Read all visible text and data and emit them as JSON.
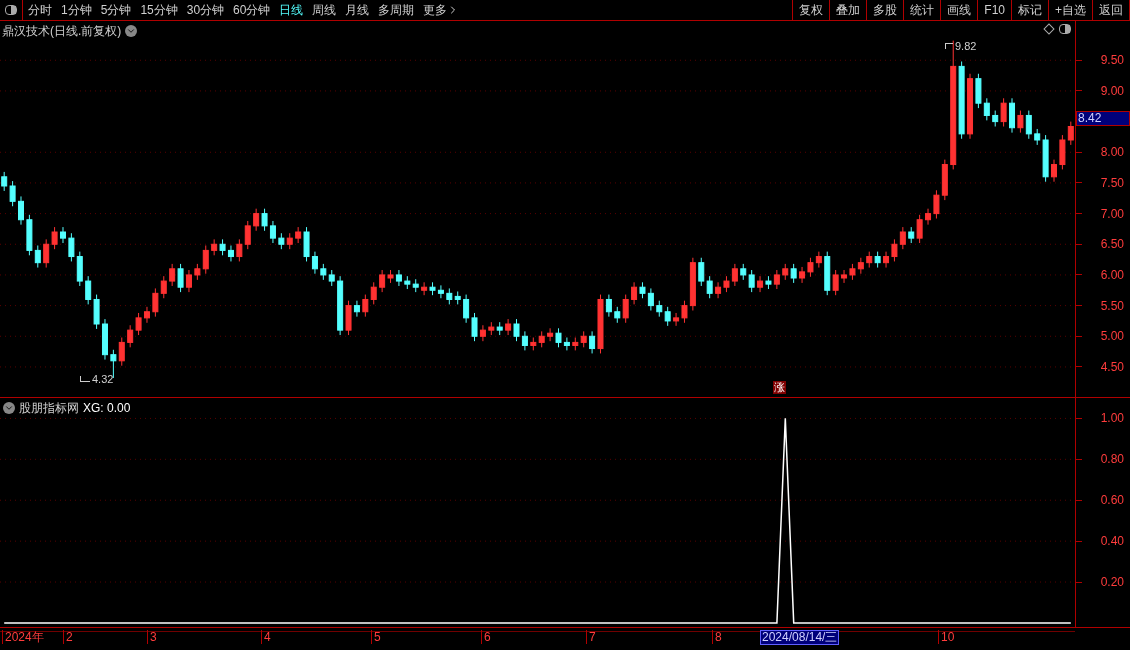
{
  "toolbar": {
    "periods": [
      {
        "label": "分时",
        "selected": false
      },
      {
        "label": "1分钟",
        "selected": false
      },
      {
        "label": "5分钟",
        "selected": false
      },
      {
        "label": "15分钟",
        "selected": false
      },
      {
        "label": "30分钟",
        "selected": false
      },
      {
        "label": "60分钟",
        "selected": false
      },
      {
        "label": "日线",
        "selected": true
      },
      {
        "label": "周线",
        "selected": false
      },
      {
        "label": "月线",
        "selected": false
      },
      {
        "label": "多周期",
        "selected": false
      }
    ],
    "more": "更多",
    "buttons": [
      "复权",
      "叠加",
      "多股",
      "统计",
      "画线",
      "F10",
      "标记",
      "+自选",
      "返回"
    ]
  },
  "price_panel": {
    "title": "鼎汉技术(日线.前复权)",
    "high_marker": "9.82",
    "low_marker": "4.32",
    "current_price": "8.42",
    "signal_label": "涨",
    "chart_data": {
      "type": "candlestick",
      "grid": true,
      "ylim": [
        4.01,
        10.14
      ],
      "yticks": [
        {
          "value": 9.5,
          "label": "9.50"
        },
        {
          "value": 9.0,
          "label": "9.00"
        },
        {
          "value": 8.0,
          "label": "8.00"
        },
        {
          "value": 7.5,
          "label": "7.50"
        },
        {
          "value": 7.0,
          "label": "7.00"
        },
        {
          "value": 6.5,
          "label": "6.50"
        },
        {
          "value": 6.0,
          "label": "6.00"
        },
        {
          "value": 5.5,
          "label": "5.50"
        },
        {
          "value": 5.0,
          "label": "5.00"
        },
        {
          "value": 4.5,
          "label": "4.50"
        }
      ],
      "categories": [
        null,
        null,
        null,
        null,
        null,
        null,
        null,
        null,
        null,
        null,
        null,
        null,
        null,
        null,
        null,
        null,
        null,
        null,
        null,
        null,
        null,
        null,
        null,
        null,
        null,
        null,
        null,
        null,
        null,
        null,
        null,
        null,
        null,
        null,
        null,
        null,
        null,
        null,
        null,
        null,
        null,
        null,
        null,
        null,
        null,
        null,
        null,
        null,
        null,
        null,
        null,
        null,
        null,
        null,
        null,
        null,
        null,
        null,
        null,
        null,
        null,
        null,
        null,
        null,
        null,
        null,
        null,
        null,
        null,
        null,
        null,
        null,
        null,
        null,
        null,
        null,
        null,
        null,
        null,
        null,
        null,
        null,
        null,
        null,
        null,
        null,
        null,
        null,
        null,
        null,
        null,
        null,
        null,
        null,
        null,
        null,
        null,
        null,
        null,
        null,
        null,
        null,
        null,
        null,
        null,
        null,
        null,
        null,
        null,
        null,
        null,
        null,
        null,
        null,
        null,
        null,
        null,
        null,
        null,
        null,
        null,
        null,
        null,
        null,
        null,
        null,
        null,
        null
      ],
      "ohlc": [
        [
          7.6,
          7.68,
          7.37,
          7.45
        ],
        [
          7.45,
          7.53,
          7.12,
          7.2
        ],
        [
          7.2,
          7.28,
          6.82,
          6.9
        ],
        [
          6.9,
          6.98,
          6.32,
          6.4
        ],
        [
          6.4,
          6.48,
          6.12,
          6.2
        ],
        [
          6.2,
          6.58,
          6.12,
          6.5
        ],
        [
          6.5,
          6.78,
          6.42,
          6.7
        ],
        [
          6.7,
          6.78,
          6.52,
          6.6
        ],
        [
          6.6,
          6.68,
          6.22,
          6.3
        ],
        [
          6.3,
          6.38,
          5.82,
          5.9
        ],
        [
          5.9,
          5.98,
          5.52,
          5.6
        ],
        [
          5.6,
          5.68,
          5.12,
          5.2
        ],
        [
          5.2,
          5.28,
          4.62,
          4.7
        ],
        [
          4.7,
          4.78,
          4.32,
          4.6
        ],
        [
          4.6,
          4.98,
          4.52,
          4.9
        ],
        [
          4.9,
          5.18,
          4.82,
          5.1
        ],
        [
          5.1,
          5.38,
          5.02,
          5.3
        ],
        [
          5.3,
          5.48,
          5.22,
          5.4
        ],
        [
          5.4,
          5.78,
          5.32,
          5.7
        ],
        [
          5.7,
          5.98,
          5.62,
          5.9
        ],
        [
          5.9,
          6.18,
          5.82,
          6.1
        ],
        [
          6.1,
          6.18,
          5.72,
          5.8
        ],
        [
          5.8,
          6.08,
          5.72,
          6.0
        ],
        [
          6.0,
          6.18,
          5.92,
          6.1
        ],
        [
          6.1,
          6.48,
          6.02,
          6.4
        ],
        [
          6.4,
          6.58,
          6.32,
          6.5
        ],
        [
          6.5,
          6.58,
          6.32,
          6.4
        ],
        [
          6.4,
          6.48,
          6.22,
          6.3
        ],
        [
          6.3,
          6.58,
          6.22,
          6.5
        ],
        [
          6.5,
          6.88,
          6.42,
          6.8
        ],
        [
          6.8,
          7.08,
          6.72,
          7.0
        ],
        [
          7.0,
          7.08,
          6.72,
          6.8
        ],
        [
          6.8,
          6.88,
          6.52,
          6.6
        ],
        [
          6.6,
          6.68,
          6.42,
          6.5
        ],
        [
          6.5,
          6.68,
          6.42,
          6.6
        ],
        [
          6.6,
          6.78,
          6.52,
          6.7
        ],
        [
          6.7,
          6.78,
          6.22,
          6.3
        ],
        [
          6.3,
          6.38,
          6.02,
          6.1
        ],
        [
          6.1,
          6.18,
          5.92,
          6.0
        ],
        [
          6.0,
          6.08,
          5.82,
          5.9
        ],
        [
          5.9,
          5.98,
          5.02,
          5.1
        ],
        [
          5.1,
          5.58,
          5.02,
          5.5
        ],
        [
          5.5,
          5.58,
          5.32,
          5.4
        ],
        [
          5.4,
          5.68,
          5.32,
          5.6
        ],
        [
          5.6,
          5.88,
          5.52,
          5.8
        ],
        [
          5.8,
          6.08,
          5.72,
          6.0
        ],
        [
          5.95,
          6.08,
          5.87,
          6.0
        ],
        [
          6.0,
          6.08,
          5.82,
          5.9
        ],
        [
          5.9,
          5.98,
          5.77,
          5.85
        ],
        [
          5.85,
          5.93,
          5.72,
          5.8
        ],
        [
          5.75,
          5.88,
          5.67,
          5.8
        ],
        [
          5.8,
          5.88,
          5.67,
          5.75
        ],
        [
          5.75,
          5.83,
          5.62,
          5.7
        ],
        [
          5.7,
          5.78,
          5.52,
          5.6
        ],
        [
          5.65,
          5.73,
          5.52,
          5.6
        ],
        [
          5.6,
          5.68,
          5.22,
          5.3
        ],
        [
          5.3,
          5.38,
          4.92,
          5.0
        ],
        [
          5.0,
          5.18,
          4.92,
          5.1
        ],
        [
          5.1,
          5.23,
          5.02,
          5.15
        ],
        [
          5.15,
          5.23,
          5.02,
          5.1
        ],
        [
          5.1,
          5.28,
          5.02,
          5.2
        ],
        [
          5.2,
          5.28,
          4.92,
          5.0
        ],
        [
          5.0,
          5.08,
          4.77,
          4.85
        ],
        [
          4.85,
          4.98,
          4.77,
          4.9
        ],
        [
          4.9,
          5.08,
          4.82,
          5.0
        ],
        [
          5.0,
          5.13,
          4.92,
          5.05
        ],
        [
          5.05,
          5.13,
          4.82,
          4.9
        ],
        [
          4.9,
          4.98,
          4.77,
          4.85
        ],
        [
          4.85,
          4.98,
          4.77,
          4.9
        ],
        [
          4.9,
          5.08,
          4.82,
          5.0
        ],
        [
          5.0,
          5.08,
          4.72,
          4.8
        ],
        [
          4.8,
          5.68,
          4.72,
          5.6
        ],
        [
          5.6,
          5.68,
          5.32,
          5.4
        ],
        [
          5.4,
          5.48,
          5.22,
          5.3
        ],
        [
          5.3,
          5.68,
          5.22,
          5.6
        ],
        [
          5.6,
          5.88,
          5.52,
          5.8
        ],
        [
          5.8,
          5.88,
          5.62,
          5.7
        ],
        [
          5.7,
          5.78,
          5.42,
          5.5
        ],
        [
          5.5,
          5.58,
          5.32,
          5.4
        ],
        [
          5.4,
          5.48,
          5.17,
          5.25
        ],
        [
          5.25,
          5.38,
          5.17,
          5.3
        ],
        [
          5.3,
          5.58,
          5.22,
          5.5
        ],
        [
          5.5,
          6.28,
          5.42,
          6.2
        ],
        [
          6.2,
          6.28,
          5.82,
          5.9
        ],
        [
          5.9,
          5.98,
          5.62,
          5.7
        ],
        [
          5.7,
          5.88,
          5.62,
          5.8
        ],
        [
          5.8,
          5.98,
          5.72,
          5.9
        ],
        [
          5.9,
          6.18,
          5.82,
          6.1
        ],
        [
          6.1,
          6.18,
          5.92,
          6.0
        ],
        [
          6.0,
          6.08,
          5.72,
          5.8
        ],
        [
          5.8,
          5.98,
          5.72,
          5.9
        ],
        [
          5.9,
          5.98,
          5.77,
          5.85
        ],
        [
          5.85,
          6.08,
          5.77,
          6.0
        ],
        [
          6.0,
          6.18,
          5.92,
          6.1
        ],
        [
          6.1,
          6.18,
          5.87,
          5.95
        ],
        [
          5.95,
          6.13,
          5.87,
          6.05
        ],
        [
          6.05,
          6.28,
          5.97,
          6.2
        ],
        [
          6.2,
          6.38,
          6.12,
          6.3
        ],
        [
          6.3,
          6.38,
          5.67,
          5.75
        ],
        [
          5.75,
          6.08,
          5.67,
          6.0
        ],
        [
          5.95,
          6.08,
          5.87,
          6.0
        ],
        [
          6.0,
          6.18,
          5.92,
          6.1
        ],
        [
          6.1,
          6.28,
          6.02,
          6.2
        ],
        [
          6.2,
          6.38,
          6.12,
          6.3
        ],
        [
          6.3,
          6.38,
          6.12,
          6.2
        ],
        [
          6.2,
          6.38,
          6.12,
          6.3
        ],
        [
          6.3,
          6.58,
          6.22,
          6.5
        ],
        [
          6.5,
          6.78,
          6.42,
          6.7
        ],
        [
          6.7,
          6.78,
          6.52,
          6.6
        ],
        [
          6.6,
          6.98,
          6.52,
          6.9
        ],
        [
          6.9,
          7.08,
          6.82,
          7.0
        ],
        [
          7.0,
          7.38,
          6.92,
          7.3
        ],
        [
          7.3,
          7.88,
          7.22,
          7.8
        ],
        [
          7.8,
          9.82,
          7.72,
          9.4
        ],
        [
          9.4,
          9.48,
          8.22,
          8.3
        ],
        [
          8.3,
          9.28,
          8.22,
          9.2
        ],
        [
          9.2,
          9.28,
          8.72,
          8.8
        ],
        [
          8.8,
          8.88,
          8.52,
          8.6
        ],
        [
          8.6,
          8.68,
          8.42,
          8.5
        ],
        [
          8.5,
          8.88,
          8.42,
          8.8
        ],
        [
          8.8,
          8.88,
          8.32,
          8.4
        ],
        [
          8.4,
          8.68,
          8.32,
          8.6
        ],
        [
          8.6,
          8.68,
          8.22,
          8.3
        ],
        [
          8.3,
          8.38,
          8.12,
          8.2
        ],
        [
          8.2,
          8.28,
          7.52,
          7.6
        ],
        [
          7.6,
          7.88,
          7.52,
          7.8
        ],
        [
          7.8,
          8.28,
          7.72,
          8.2
        ],
        [
          8.2,
          8.5,
          8.12,
          8.42
        ]
      ]
    }
  },
  "indicator_panel": {
    "title": "股朋指标网",
    "readout": ": 0.00",
    "chart_data": {
      "type": "line",
      "categories": [
        null,
        null,
        null,
        null,
        null,
        null,
        null,
        null,
        null,
        null,
        null,
        null,
        null,
        null,
        null,
        null,
        null,
        null,
        null,
        null,
        null,
        null,
        null,
        null,
        null,
        null,
        null,
        null,
        null,
        null,
        null,
        null,
        null,
        null,
        null,
        null,
        null,
        null,
        null,
        null,
        null,
        null,
        null,
        null,
        null,
        null,
        null,
        null,
        null,
        null,
        null,
        null,
        null,
        null,
        null,
        null,
        null,
        null,
        null,
        null,
        null,
        null,
        null,
        null,
        null,
        null,
        null,
        null,
        null,
        null,
        null,
        null,
        null,
        null,
        null,
        null,
        null,
        null,
        null,
        null,
        null,
        null,
        null,
        null,
        null,
        null,
        null,
        null,
        null,
        null,
        null,
        null,
        null,
        null,
        null,
        null,
        null,
        null,
        null,
        null,
        null,
        null,
        null,
        null,
        null,
        null,
        null,
        null,
        null,
        null,
        null,
        null,
        null,
        null,
        null,
        null,
        null,
        null,
        null,
        null,
        null,
        null,
        null,
        null,
        null,
        null,
        null,
        null
      ],
      "grid": true,
      "ylim": [
        -0.02,
        1.1
      ],
      "yticks": [
        {
          "value": 1.0,
          "label": "1.00"
        },
        {
          "value": 0.8,
          "label": "0.80"
        },
        {
          "value": 0.6,
          "label": "0.60"
        },
        {
          "value": 0.4,
          "label": "0.40"
        },
        {
          "value": 0.2,
          "label": "0.20"
        }
      ],
      "series": [
        {
          "name": "XG",
          "color": "#ffffff",
          "values": [
            0,
            0,
            0,
            0,
            0,
            0,
            0,
            0,
            0,
            0,
            0,
            0,
            0,
            0,
            0,
            0,
            0,
            0,
            0,
            0,
            0,
            0,
            0,
            0,
            0,
            0,
            0,
            0,
            0,
            0,
            0,
            0,
            0,
            0,
            0,
            0,
            0,
            0,
            0,
            0,
            0,
            0,
            0,
            0,
            0,
            0,
            0,
            0,
            0,
            0,
            0,
            0,
            0,
            0,
            0,
            0,
            0,
            0,
            0,
            0,
            0,
            0,
            0,
            0,
            0,
            0,
            0,
            0,
            0,
            0,
            0,
            0,
            0,
            0,
            0,
            0,
            0,
            0,
            0,
            0,
            0,
            0,
            0,
            0,
            0,
            0,
            0,
            0,
            0,
            0,
            0,
            0,
            0,
            1,
            0,
            0,
            0,
            0,
            0,
            0,
            0,
            0,
            0,
            0,
            0,
            0,
            0,
            0,
            0,
            0,
            0,
            0,
            0,
            0,
            0,
            0,
            0,
            0,
            0,
            0,
            0,
            0,
            0,
            0,
            0,
            0,
            0,
            0
          ]
        }
      ]
    }
  },
  "time_axis": {
    "labels": [
      "2024年",
      "2",
      "3",
      "4",
      "5",
      "6",
      "7",
      "8",
      "10"
    ],
    "cursor_date": "2024/08/14/三"
  }
}
